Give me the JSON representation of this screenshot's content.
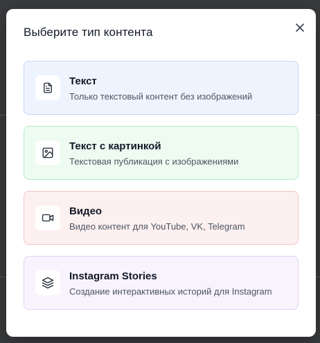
{
  "modal": {
    "title": "Выберите тип контента",
    "close_icon": "close-icon"
  },
  "content_types": [
    {
      "label": "Текст",
      "description": "Только текстовый контент без изображений",
      "icon": "document-icon",
      "color": "#eef4fe"
    },
    {
      "label": "Текст с картинкой",
      "description": "Текстовая публикация с изображениями",
      "icon": "image-icon",
      "color": "#edfbf1"
    },
    {
      "label": "Видео",
      "description": "Видео контент для YouTube, VK, Telegram",
      "icon": "video-camera-icon",
      "color": "#fdf0f0"
    },
    {
      "label": "Instagram Stories",
      "description": "Создание интерактивных историй для Instagram",
      "icon": "layers-icon",
      "color": "#f8f3fd"
    }
  ]
}
